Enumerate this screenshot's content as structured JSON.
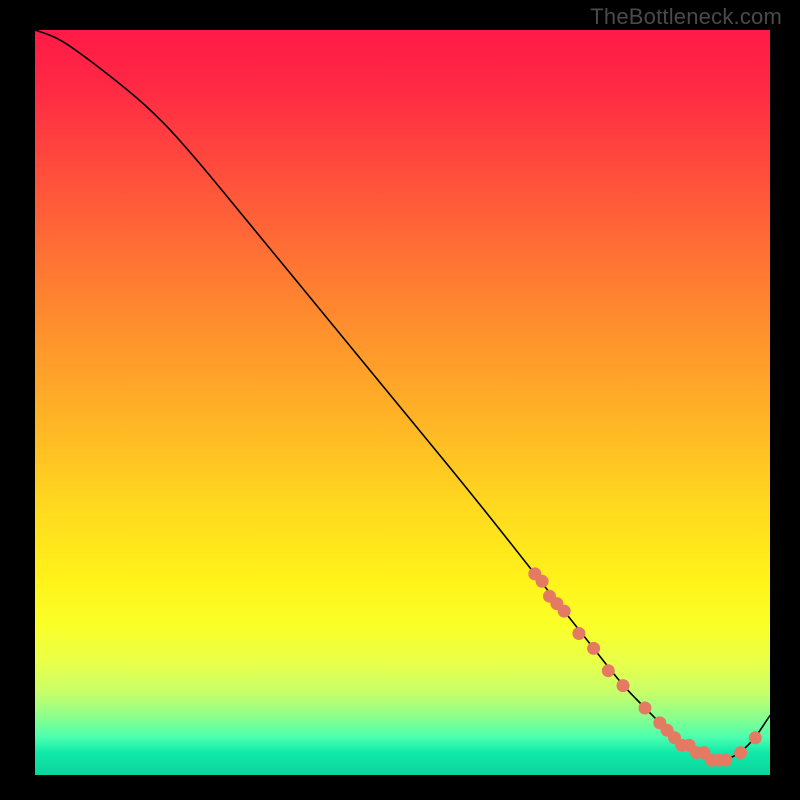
{
  "watermark": "TheBottleneck.com",
  "chart_data": {
    "type": "line",
    "title": "",
    "xlabel": "",
    "ylabel": "",
    "xlim": [
      0,
      100
    ],
    "ylim": [
      0,
      100
    ],
    "x": [
      0,
      3,
      6,
      10,
      15,
      20,
      30,
      40,
      50,
      60,
      68,
      72,
      76,
      80,
      83,
      86,
      88,
      90,
      92,
      94,
      96,
      98,
      100
    ],
    "values": [
      100,
      99,
      97,
      94,
      90,
      85,
      73,
      61,
      49,
      37,
      27,
      22,
      17,
      12,
      9,
      6,
      4,
      3,
      2,
      2,
      3,
      5,
      8
    ],
    "markers_x": [
      68,
      69,
      70,
      71,
      72,
      74,
      76,
      78,
      80,
      83,
      85,
      86,
      87,
      88,
      89,
      90,
      91,
      92,
      93,
      94,
      96,
      98
    ],
    "markers_y": [
      27,
      26,
      24,
      23,
      22,
      19,
      17,
      14,
      12,
      9,
      7,
      6,
      5,
      4,
      4,
      3,
      3,
      2,
      2,
      2,
      3,
      5
    ]
  },
  "colors": {
    "marker": "#e57a63",
    "line": "#000000"
  }
}
